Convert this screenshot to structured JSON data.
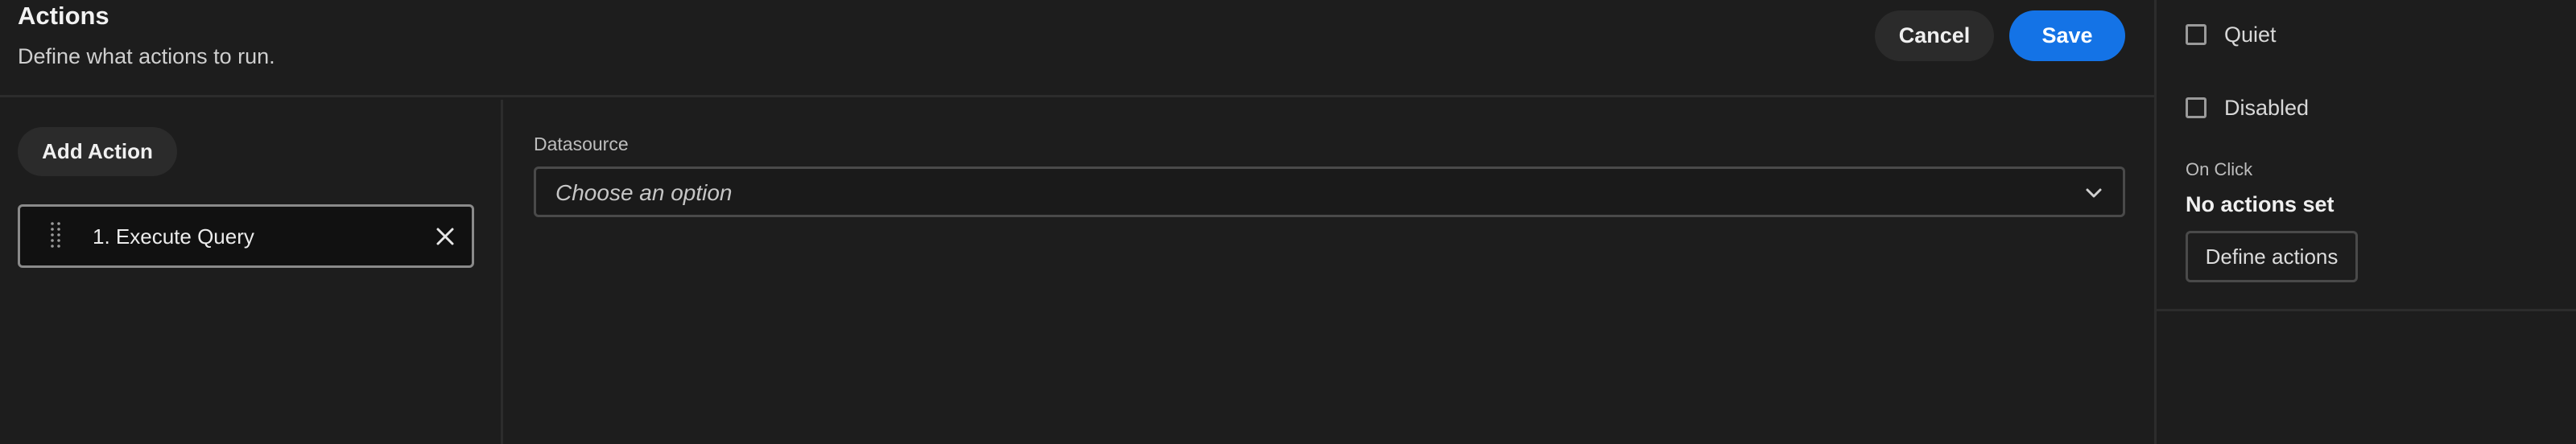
{
  "dialog": {
    "title": "Actions",
    "subtitle": "Define what actions to run.",
    "cancel_label": "Cancel",
    "save_label": "Save",
    "add_action_label": "Add Action",
    "actions": [
      {
        "label": "1. Execute Query"
      }
    ],
    "datasource": {
      "label": "Datasource",
      "placeholder": "Choose an option"
    }
  },
  "panel": {
    "quiet_label": "Quiet",
    "disabled_label": "Disabled",
    "on_click_label": "On Click",
    "no_actions_label": "No actions set",
    "define_actions_label": "Define actions"
  },
  "colors": {
    "background": "#1d1d1d",
    "accent": "#1473e6",
    "border": "#2c2c2c"
  },
  "icons": {
    "grip": "drag-handle-icon",
    "close": "close-icon",
    "chevron": "chevron-down-icon"
  }
}
